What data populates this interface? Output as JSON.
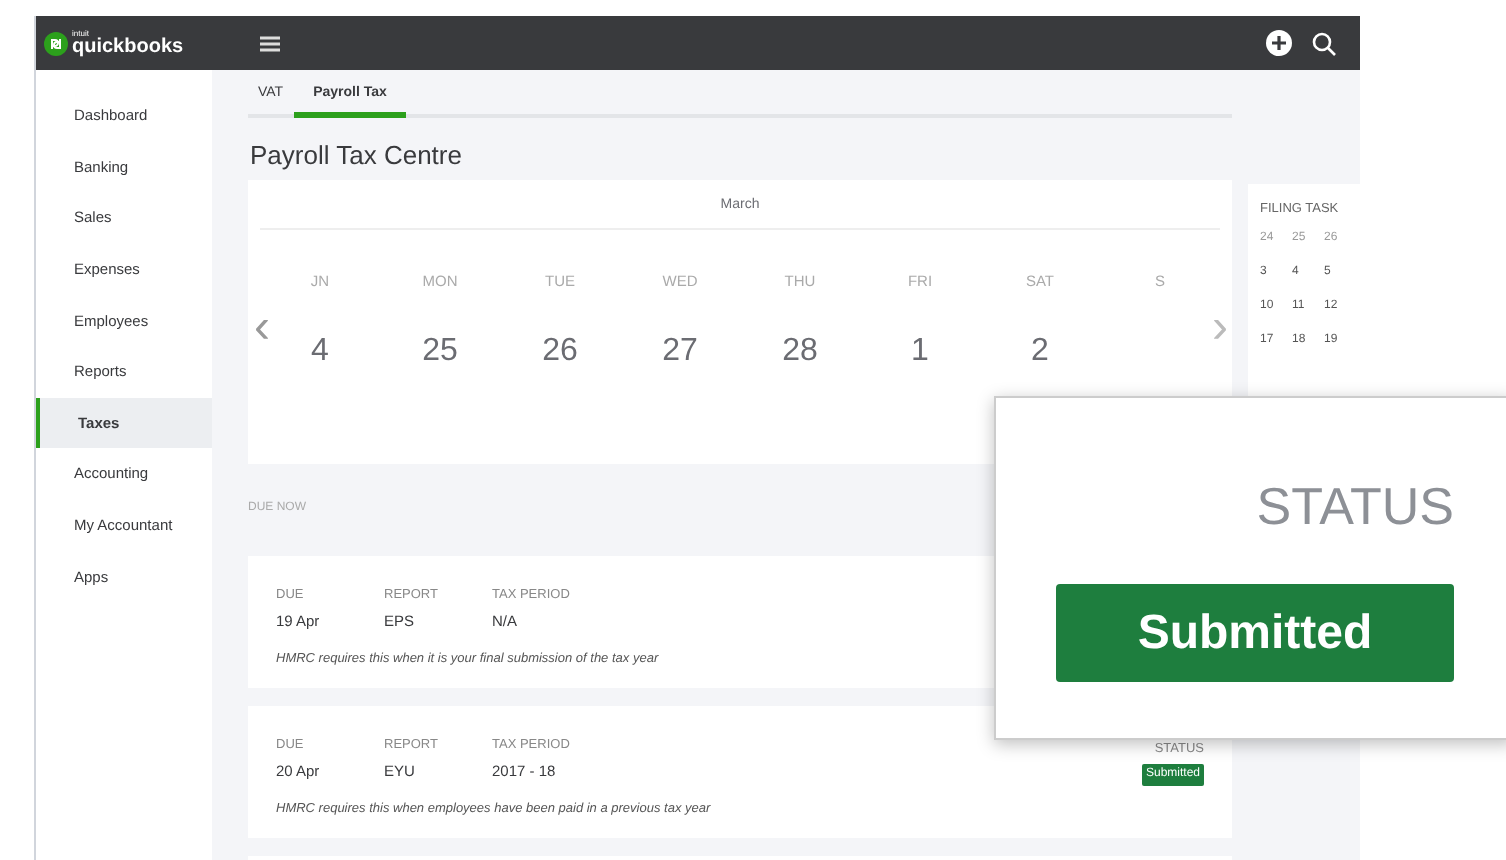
{
  "topbar": {
    "logo_small": "intuit",
    "logo": "quickbooks"
  },
  "sidebar": {
    "items": [
      {
        "label": "Dashboard",
        "selected": false
      },
      {
        "label": "Banking",
        "selected": false
      },
      {
        "label": "Sales",
        "selected": false
      },
      {
        "label": "Expenses",
        "selected": false
      },
      {
        "label": "Employees",
        "selected": false
      },
      {
        "label": "Reports",
        "selected": false
      },
      {
        "label": "Taxes",
        "selected": true
      },
      {
        "label": "Accounting",
        "selected": false
      },
      {
        "label": "My Accountant",
        "selected": false
      },
      {
        "label": "Apps",
        "selected": false
      }
    ]
  },
  "tabs": [
    {
      "label": "VAT",
      "selected": false
    },
    {
      "label": "Payroll Tax",
      "selected": true
    }
  ],
  "page_title": "Payroll Tax Centre",
  "calendar": {
    "month": "March",
    "prev": "‹",
    "next": "›",
    "days": [
      {
        "weekday": "JN",
        "date": "4"
      },
      {
        "weekday": "MON",
        "date": "25"
      },
      {
        "weekday": "TUE",
        "date": "26"
      },
      {
        "weekday": "WED",
        "date": "27"
      },
      {
        "weekday": "THU",
        "date": "28"
      },
      {
        "weekday": "FRI",
        "date": "1"
      },
      {
        "weekday": "SAT",
        "date": "2"
      },
      {
        "weekday": "S"
      }
    ]
  },
  "filing_tasks": {
    "title": "FILING TASK",
    "weeks": [
      [
        "24",
        "25",
        "26"
      ],
      [
        "3",
        "4",
        "5"
      ],
      [
        "10",
        "11",
        "12"
      ],
      [
        "17",
        "18",
        "19"
      ]
    ]
  },
  "due_now": {
    "heading": "DUE NOW",
    "items": [
      {
        "due_label": "DUE",
        "report_label": "REPORT",
        "tax_period_label": "TAX PERIOD",
        "due": "19 Apr",
        "report": "EPS",
        "tax_period": "N/A",
        "note": "HMRC requires this when it is your final submission of the tax year"
      },
      {
        "due_label": "DUE",
        "report_label": "REPORT",
        "tax_period_label": "TAX PERIOD",
        "status_label": "STATUS",
        "due": "20 Apr",
        "report": "EYU",
        "tax_period": "2017 - 18",
        "note": "HMRC requires this when employees have been paid in a previous tax year",
        "status": "Submitted"
      }
    ]
  },
  "callout": {
    "label": "STATUS",
    "badge": "Submitted"
  }
}
